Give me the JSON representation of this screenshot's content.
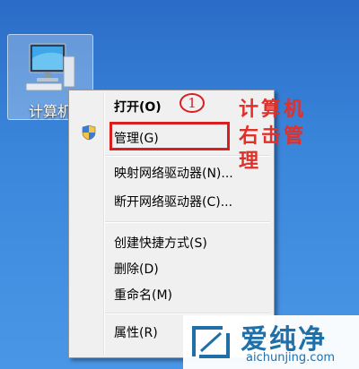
{
  "desktop": {
    "icon_label": "计算机"
  },
  "context_menu": {
    "items": [
      {
        "label": "打开(O)",
        "bold": true
      },
      {
        "label": "管理(G)",
        "shield": true
      },
      {
        "label": "映射网络驱动器(N)..."
      },
      {
        "label": "断开网络驱动器(C)..."
      },
      {
        "label": "创建快捷方式(S)"
      },
      {
        "label": "删除(D)"
      },
      {
        "label": "重命名(M)"
      },
      {
        "label": "属性(R)"
      }
    ]
  },
  "annotation": {
    "step_number": "1",
    "line1": "计算机",
    "line2": "右击管",
    "line3": "理",
    "color": "#e0302a"
  },
  "watermark": {
    "title": "爱纯净",
    "url": "aichunjing.com"
  }
}
